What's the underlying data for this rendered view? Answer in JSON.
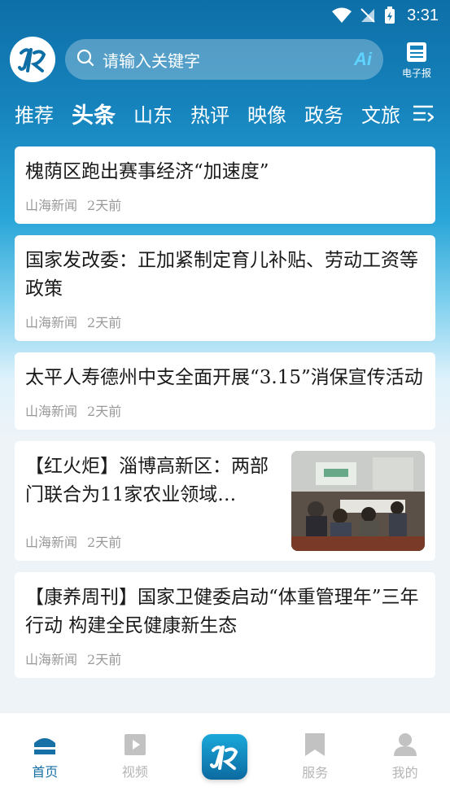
{
  "status_bar": {
    "time": "3:31"
  },
  "header": {
    "search_placeholder": "请输入关键字",
    "ai_badge": "Ai",
    "epaper_label": "电子报"
  },
  "tabs": [
    {
      "label": "推荐",
      "active": false
    },
    {
      "label": "头条",
      "active": true
    },
    {
      "label": "山东",
      "active": false
    },
    {
      "label": "热评",
      "active": false
    },
    {
      "label": "映像",
      "active": false
    },
    {
      "label": "政务",
      "active": false
    },
    {
      "label": "文旅",
      "active": false
    }
  ],
  "feed": [
    {
      "title": "槐荫区跑出赛事经济“加速度”",
      "source": "山海新闻",
      "time": "2天前"
    },
    {
      "title": "国家发改委：正加紧制定育儿补贴、劳动工资等政策",
      "source": "山海新闻",
      "time": "2天前"
    },
    {
      "title": "太平人寿德州中支全面开展“3.15”消保宣传活动",
      "source": "山海新闻",
      "time": "2天前"
    },
    {
      "title": "【红火炬】淄博高新区：两部门联合为11家农业领域…",
      "source": "山海新闻",
      "time": "2天前",
      "has_thumb": true
    },
    {
      "title": "【康养周刊】国家卫健委启动“体重管理年”三年行动 构建全民健康新生态",
      "source": "山海新闻",
      "time": "2天前"
    }
  ],
  "bottom_nav": [
    {
      "label": "首页",
      "icon": "home-icon",
      "active": true
    },
    {
      "label": "视频",
      "icon": "video-icon",
      "active": false
    },
    {
      "label": "",
      "icon": "app-logo-icon",
      "active": false
    },
    {
      "label": "服务",
      "icon": "bookmark-icon",
      "active": false
    },
    {
      "label": "我的",
      "icon": "user-icon",
      "active": false
    }
  ],
  "colors": {
    "accent": "#1670a6",
    "header_blue": "#0e6fa7",
    "meta_gray": "#999999"
  }
}
